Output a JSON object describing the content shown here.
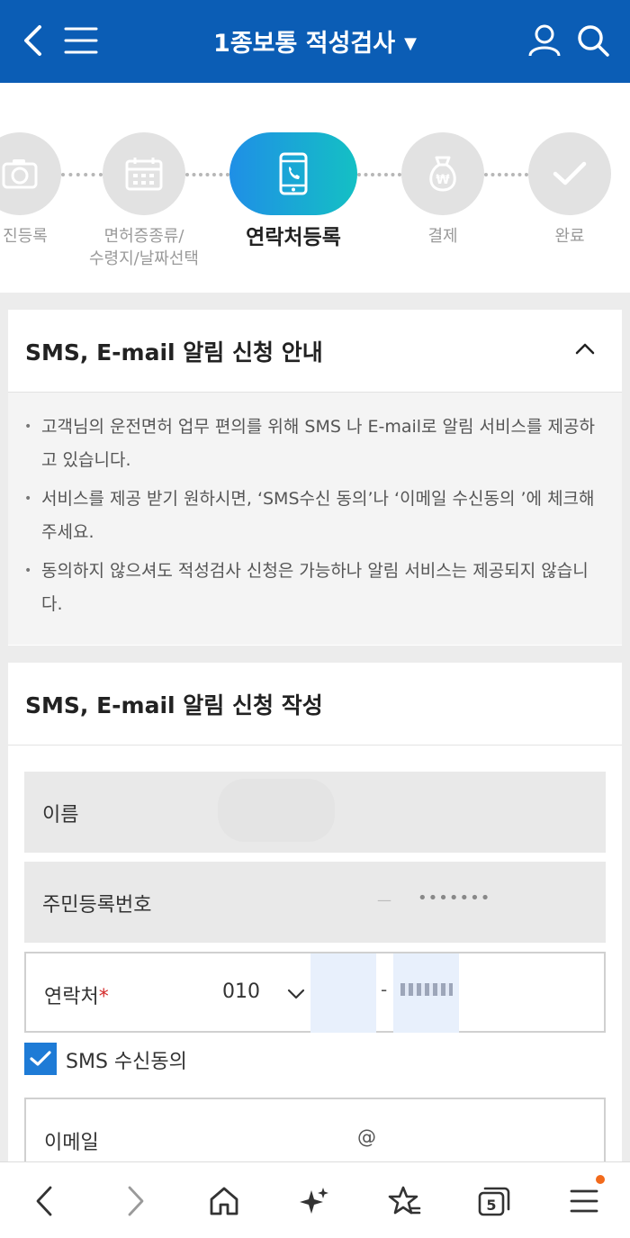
{
  "header": {
    "title": "1종보통 적성검사",
    "title_caret": "▼"
  },
  "steps": [
    {
      "label": "진등록",
      "icon": "camera-icon"
    },
    {
      "label": "면허증종류/\n수령지/날짜선택",
      "icon": "calendar-icon"
    },
    {
      "label": "연락처등록",
      "icon": "phone-icon"
    },
    {
      "label": "결제",
      "icon": "money-bag-icon"
    },
    {
      "label": "완료",
      "icon": "check-icon"
    }
  ],
  "notice": {
    "title": "SMS, E-mail 알림 신청 안내",
    "items": [
      "고객님의 운전면허 업무 편의를 위해 SMS 나 E-mail로 알림 서비스를 제공하고 있습니다.",
      "서비스를 제공 받기 원하시면, ‘SMS수신 동의’나 ‘이메일 수신동의 ’에 체크해주세요.",
      "동의하지 않으셔도 적성검사 신청은 가능하나 알림 서비스는 제공되지 않습니다."
    ]
  },
  "form": {
    "title": "SMS, E-mail 알림 신청 작성",
    "name_label": "이름",
    "rrn_label": "주민등록번호",
    "rrn_separator": "—",
    "rrn_masked": "•••••••",
    "phone_label": "연락처",
    "phone_required": "*",
    "phone_prefix": "010",
    "phone_dash": "-",
    "sms_consent_label": "SMS 수신동의",
    "email_label": "이메일",
    "email_at": "@"
  },
  "bottom_bar": {
    "tabs_count": "5",
    "icons": [
      "back-icon",
      "forward-icon",
      "home-icon",
      "sparkle-icon",
      "bookmark-star-icon",
      "tabs-icon",
      "menu-icon"
    ]
  },
  "colors": {
    "header_bg": "#0b5db5",
    "accent": "#1e7bd6",
    "notification_dot": "#f26a1b"
  }
}
